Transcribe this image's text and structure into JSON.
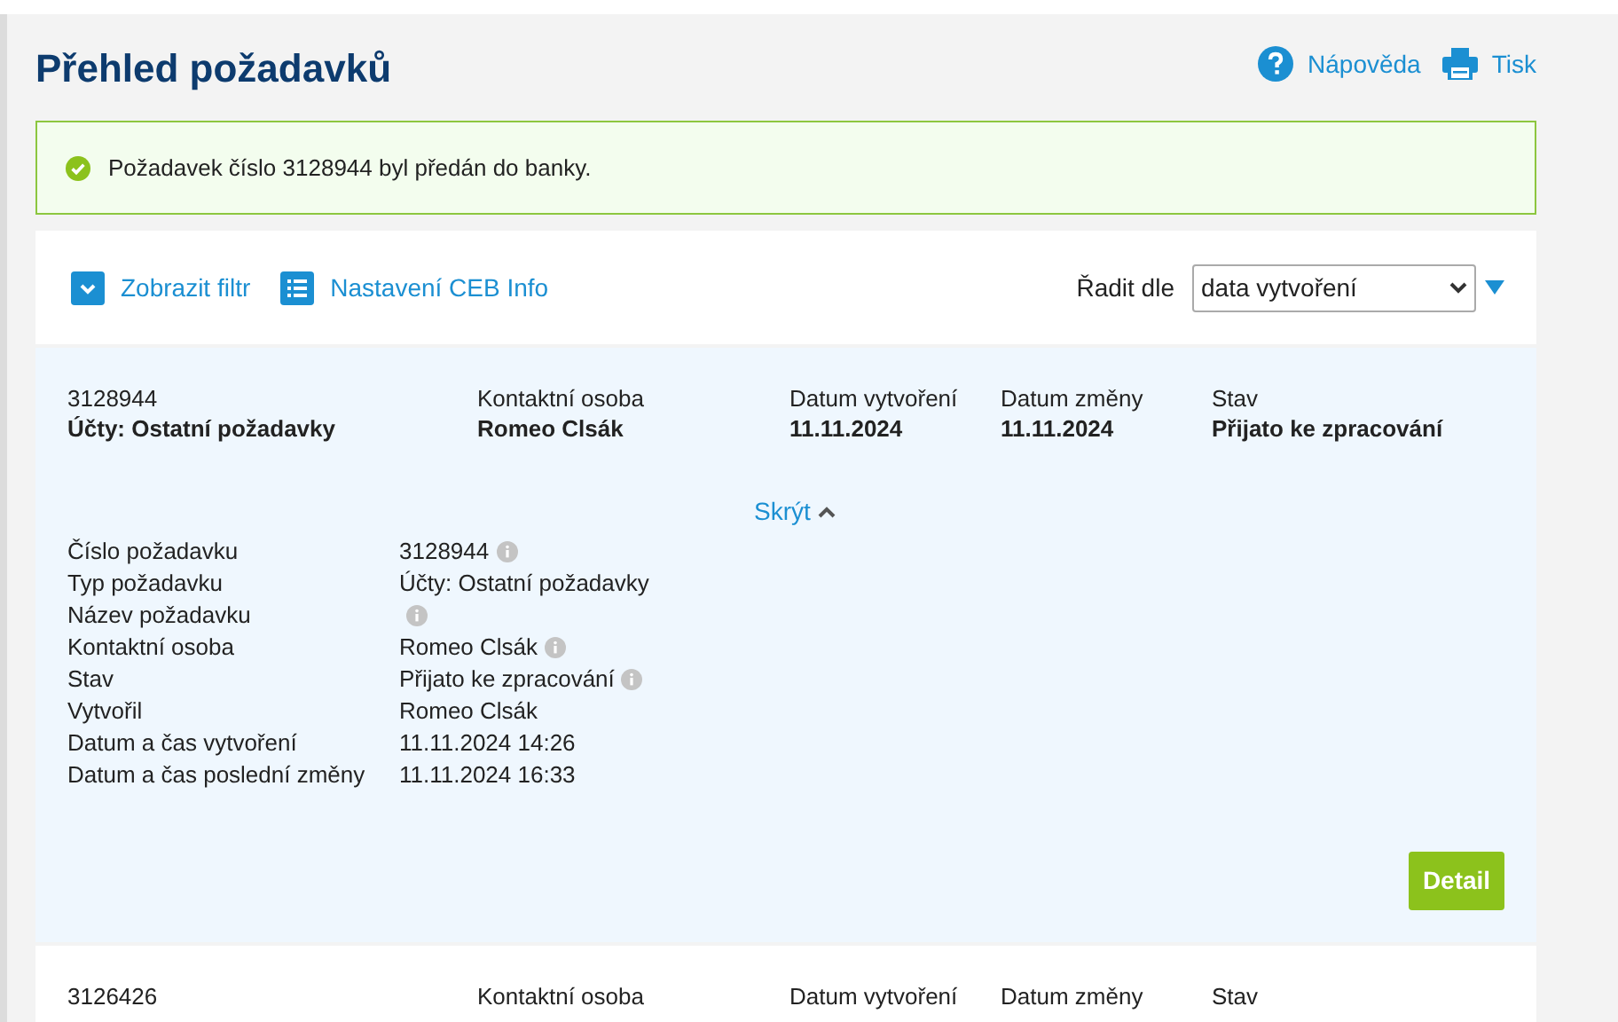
{
  "title": "Přehled požadavků",
  "header_links": [
    {
      "kind": "help",
      "label": "Nápověda"
    },
    {
      "kind": "print",
      "label": "Tisk"
    }
  ],
  "alert": {
    "message": "Požadavek číslo 3128944 byl předán do banky."
  },
  "toolbar": {
    "filter_label": "Zobrazit filtr",
    "settings_label": "Nastavení CEB Info",
    "sort_label": "Řadit dle",
    "sort_value": "data vytvoření"
  },
  "requests": [
    {
      "expanded": true,
      "number": "3128944",
      "type": "Účty: Ostatní požadavky",
      "columns": [
        {
          "label": "Kontaktní osoba",
          "value": "Romeo Clsák"
        },
        {
          "label": "Datum vytvoření",
          "value": "11.11.2024"
        },
        {
          "label": "Datum změny",
          "value": "11.11.2024"
        },
        {
          "label": "Stav",
          "value": "Přijato ke zpracování"
        }
      ],
      "toggle_label": "Skrýt",
      "details": [
        {
          "label": "Číslo požadavku",
          "value": "3128944",
          "info": true
        },
        {
          "label": "Typ požadavku",
          "value": "Účty: Ostatní požadavky",
          "info": false
        },
        {
          "label": "Název požadavku",
          "info": true
        },
        {
          "label": "Kontaktní osoba",
          "value": "Romeo Clsák",
          "info": true
        },
        {
          "label": "Stav",
          "value": "Přijato ke zpracování",
          "info": true
        },
        {
          "label": "Vytvořil",
          "value": "Romeo Clsák",
          "info": false
        },
        {
          "label": "Datum a čas vytvoření",
          "value": "11.11.2024 14:26",
          "info": false
        },
        {
          "label": "Datum a čas poslední změny",
          "value": "11.11.2024 16:33",
          "info": false
        }
      ],
      "detail_button": "Detail"
    },
    {
      "expanded": false,
      "number": "3126426",
      "columns": [
        {
          "label": "Kontaktní osoba"
        },
        {
          "label": "Datum vytvoření"
        },
        {
          "label": "Datum změny"
        },
        {
          "label": "Stav"
        }
      ]
    }
  ]
}
